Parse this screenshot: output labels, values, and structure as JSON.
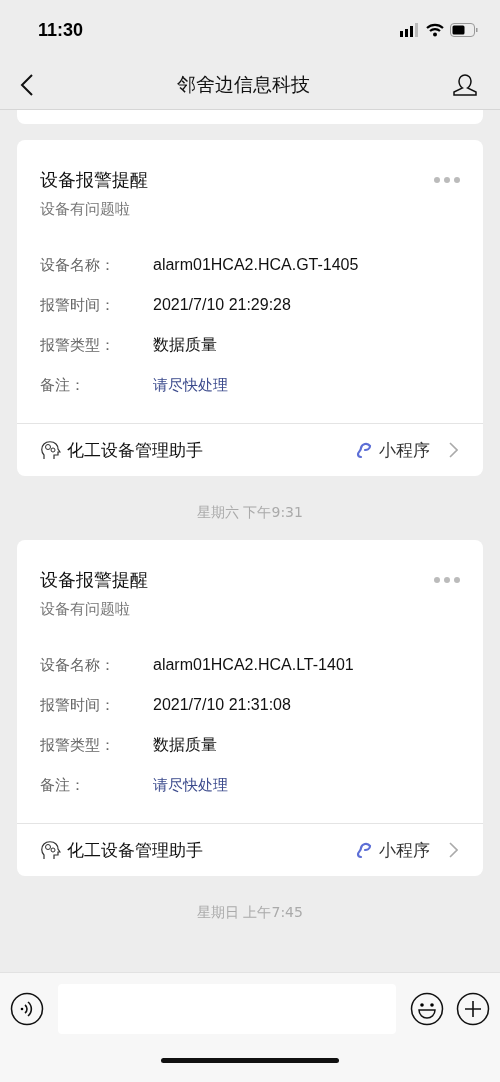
{
  "status_bar": {
    "time": "11:30"
  },
  "nav": {
    "title": "邻舍边信息科技"
  },
  "messages": [
    {
      "title": "设备报警提醒",
      "subtitle": "设备有问题啦",
      "fields": [
        {
          "label": "设备名称：",
          "value": "alarm01HCA2.HCA.GT-1405",
          "kind": "plain"
        },
        {
          "label": "报警时间：",
          "value": "2021/7/10 21:29:28",
          "kind": "plain"
        },
        {
          "label": "报警类型：",
          "value": "数据质量",
          "kind": "plain"
        },
        {
          "label": "备注：",
          "value": "请尽快处理",
          "kind": "link"
        }
      ],
      "app_name": "化工设备管理助手",
      "app_tag": "小程序"
    },
    {
      "timestamp": "星期六 下午9:31",
      "title": "设备报警提醒",
      "subtitle": "设备有问题啦",
      "fields": [
        {
          "label": "设备名称：",
          "value": "alarm01HCA2.HCA.LT-1401",
          "kind": "plain"
        },
        {
          "label": "报警时间：",
          "value": "2021/7/10 21:31:08",
          "kind": "plain"
        },
        {
          "label": "报警类型：",
          "value": "数据质量",
          "kind": "plain"
        },
        {
          "label": "备注：",
          "value": "请尽快处理",
          "kind": "link"
        }
      ],
      "app_name": "化工设备管理助手",
      "app_tag": "小程序"
    }
  ],
  "last_timestamp": "星期日 上午7:45"
}
